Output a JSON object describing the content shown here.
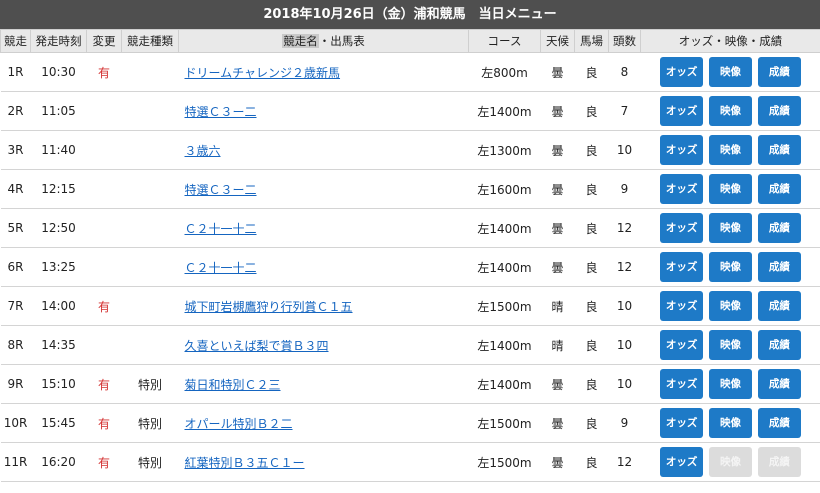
{
  "title": "2018年10月26日（金）浦和競馬　当日メニュー",
  "headers": {
    "race_no": "競走",
    "start_time": "発走時刻",
    "change": "変更",
    "race_type": "競走種類",
    "race_name_a": "競走名",
    "race_name_b": "・出馬表",
    "course": "コース",
    "weather": "天候",
    "track": "馬場",
    "count": "頭数",
    "links": "オッズ・映像・成績"
  },
  "buttons": {
    "odds": "オッズ",
    "video": "映像",
    "results": "成績"
  },
  "rows": [
    {
      "no": "1R",
      "time": "10:30",
      "change": "有",
      "type": "",
      "name": "ドリームチャレンジ２歳新馬",
      "course": "左800m",
      "weather": "曇",
      "track": "良",
      "count": "8",
      "video_enabled": true,
      "results_enabled": true
    },
    {
      "no": "2R",
      "time": "11:05",
      "change": "",
      "type": "",
      "name": "特選Ｃ３ー二",
      "course": "左1400m",
      "weather": "曇",
      "track": "良",
      "count": "7",
      "video_enabled": true,
      "results_enabled": true
    },
    {
      "no": "3R",
      "time": "11:40",
      "change": "",
      "type": "",
      "name": "３歳六",
      "course": "左1300m",
      "weather": "曇",
      "track": "良",
      "count": "10",
      "video_enabled": true,
      "results_enabled": true
    },
    {
      "no": "4R",
      "time": "12:15",
      "change": "",
      "type": "",
      "name": "特選Ｃ３ー二",
      "course": "左1600m",
      "weather": "曇",
      "track": "良",
      "count": "9",
      "video_enabled": true,
      "results_enabled": true
    },
    {
      "no": "5R",
      "time": "12:50",
      "change": "",
      "type": "",
      "name": "Ｃ２十一十二",
      "course": "左1400m",
      "weather": "曇",
      "track": "良",
      "count": "12",
      "video_enabled": true,
      "results_enabled": true
    },
    {
      "no": "6R",
      "time": "13:25",
      "change": "",
      "type": "",
      "name": "Ｃ２十一十二",
      "course": "左1400m",
      "weather": "曇",
      "track": "良",
      "count": "12",
      "video_enabled": true,
      "results_enabled": true
    },
    {
      "no": "7R",
      "time": "14:00",
      "change": "有",
      "type": "",
      "name": "城下町岩槻鷹狩り行列賞Ｃ１五",
      "course": "左1500m",
      "weather": "晴",
      "track": "良",
      "count": "10",
      "video_enabled": true,
      "results_enabled": true
    },
    {
      "no": "8R",
      "time": "14:35",
      "change": "",
      "type": "",
      "name": "久喜といえば梨で賞Ｂ３四",
      "course": "左1400m",
      "weather": "晴",
      "track": "良",
      "count": "10",
      "video_enabled": true,
      "results_enabled": true
    },
    {
      "no": "9R",
      "time": "15:10",
      "change": "有",
      "type": "特別",
      "name": "菊日和特別Ｃ２三",
      "course": "左1400m",
      "weather": "曇",
      "track": "良",
      "count": "10",
      "video_enabled": true,
      "results_enabled": true
    },
    {
      "no": "10R",
      "time": "15:45",
      "change": "有",
      "type": "特別",
      "name": "オパール特別Ｂ２二",
      "course": "左1500m",
      "weather": "曇",
      "track": "良",
      "count": "9",
      "video_enabled": true,
      "results_enabled": true
    },
    {
      "no": "11R",
      "time": "16:20",
      "change": "有",
      "type": "特別",
      "name": "紅葉特別Ｂ３五Ｃ１ー",
      "course": "左1500m",
      "weather": "曇",
      "track": "良",
      "count": "12",
      "video_enabled": false,
      "results_enabled": false
    }
  ]
}
